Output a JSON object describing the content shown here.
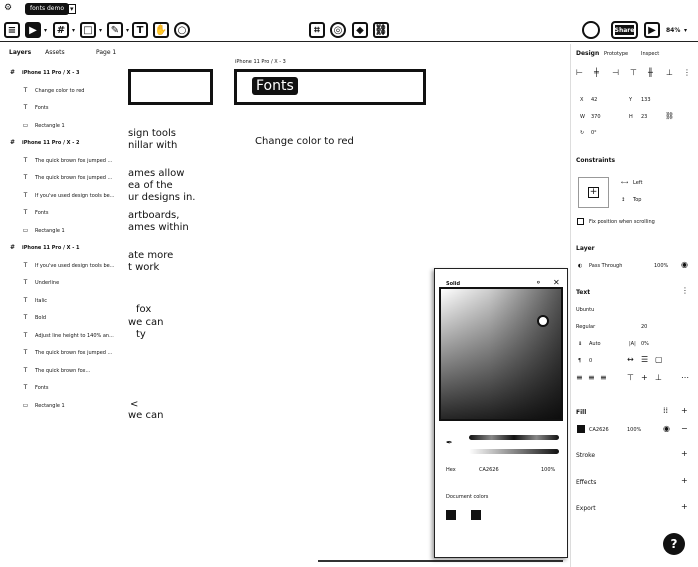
{
  "toolbar": {
    "file_name": "fonts demo",
    "share_label": "Share",
    "zoom_label": "84%"
  },
  "layers_panel": {
    "tab_layers": "Layers",
    "tab_assets": "Assets",
    "page_label": "Page 1",
    "rows": [
      {
        "icon": "frame-icon",
        "label": "iPhone 11 Pro / X - 3",
        "type": "frame"
      },
      {
        "icon": "text-icon",
        "label": "Change color to red",
        "type": "child"
      },
      {
        "icon": "text-icon",
        "label": "Fonts",
        "type": "child"
      },
      {
        "icon": "rect-icon",
        "label": "Rectangle 1",
        "type": "child"
      },
      {
        "icon": "frame-icon",
        "label": "iPhone 11 Pro / X - 2",
        "type": "frame"
      },
      {
        "icon": "text-icon",
        "label": "The quick brown fox jumped ...",
        "type": "child"
      },
      {
        "icon": "text-icon",
        "label": "The quick brown fox jumped ...",
        "type": "child"
      },
      {
        "icon": "text-icon",
        "label": "If you've used design tools be...",
        "type": "child"
      },
      {
        "icon": "text-icon",
        "label": "Fonts",
        "type": "child"
      },
      {
        "icon": "rect-icon",
        "label": "Rectangle 1",
        "type": "child"
      },
      {
        "icon": "frame-icon",
        "label": "iPhone 11 Pro / X - 1",
        "type": "frame"
      },
      {
        "icon": "text-icon",
        "label": "If you've used design tools be...",
        "type": "child"
      },
      {
        "icon": "text-icon",
        "label": "Underline",
        "type": "child"
      },
      {
        "icon": "text-icon",
        "label": "Italic",
        "type": "child"
      },
      {
        "icon": "text-icon",
        "label": "Bold",
        "type": "child"
      },
      {
        "icon": "text-icon",
        "label": "Adjust line height to 140% an...",
        "type": "child"
      },
      {
        "icon": "text-icon",
        "label": "The quick brown fox jumped ...",
        "type": "child"
      },
      {
        "icon": "text-icon",
        "label": "The quick brown fox...",
        "type": "child"
      },
      {
        "icon": "text-icon",
        "label": "Fonts",
        "type": "child"
      },
      {
        "icon": "rect-icon",
        "label": "Rectangle 1",
        "type": "child"
      }
    ]
  },
  "canvas": {
    "frame_label": "iPhone 11 Pro / X - 3",
    "fonts_title": "Fonts",
    "change_color_text": "Change color to red",
    "partial_lines": [
      "sign tools",
      "nillar with",
      "ames allow",
      "ea of the",
      "ur designs in.",
      "artboards,",
      "ames within",
      "ate more",
      "t work",
      "fox",
      "we can",
      "ty",
      "<",
      "we can"
    ]
  },
  "design_panel": {
    "tab_design": "Design",
    "tab_prototype": "Prototype",
    "tab_inspect": "Inspect",
    "x": "42",
    "y": "133",
    "w": "370",
    "h": "23",
    "rotation": "0°",
    "constraints_title": "Constraints",
    "constraint_h": "Left",
    "constraint_v": "Top",
    "fix_position_label": "Fix position when scrolling",
    "layer_title": "Layer",
    "blend_mode": "Pass Through",
    "layer_opacity": "100%",
    "text_title": "Text",
    "font_family": "Ubuntu",
    "font_weight": "Regular",
    "font_size": "20",
    "line_height": "Auto",
    "letter_spacing": "0%",
    "paragraph_spacing": "0",
    "fill_title": "Fill",
    "fill_hex": "CA2626",
    "fill_opacity": "100%",
    "stroke_title": "Stroke",
    "effects_title": "Effects",
    "export_title": "Export"
  },
  "color_picker": {
    "mode_label": "Solid",
    "format_label": "Hex",
    "hex_value": "CA2626",
    "opacity_value": "100%",
    "document_colors_label": "Document colors"
  },
  "help_label": "?",
  "colors": {
    "fill_color": "#CA2626",
    "ink": "#111111"
  }
}
